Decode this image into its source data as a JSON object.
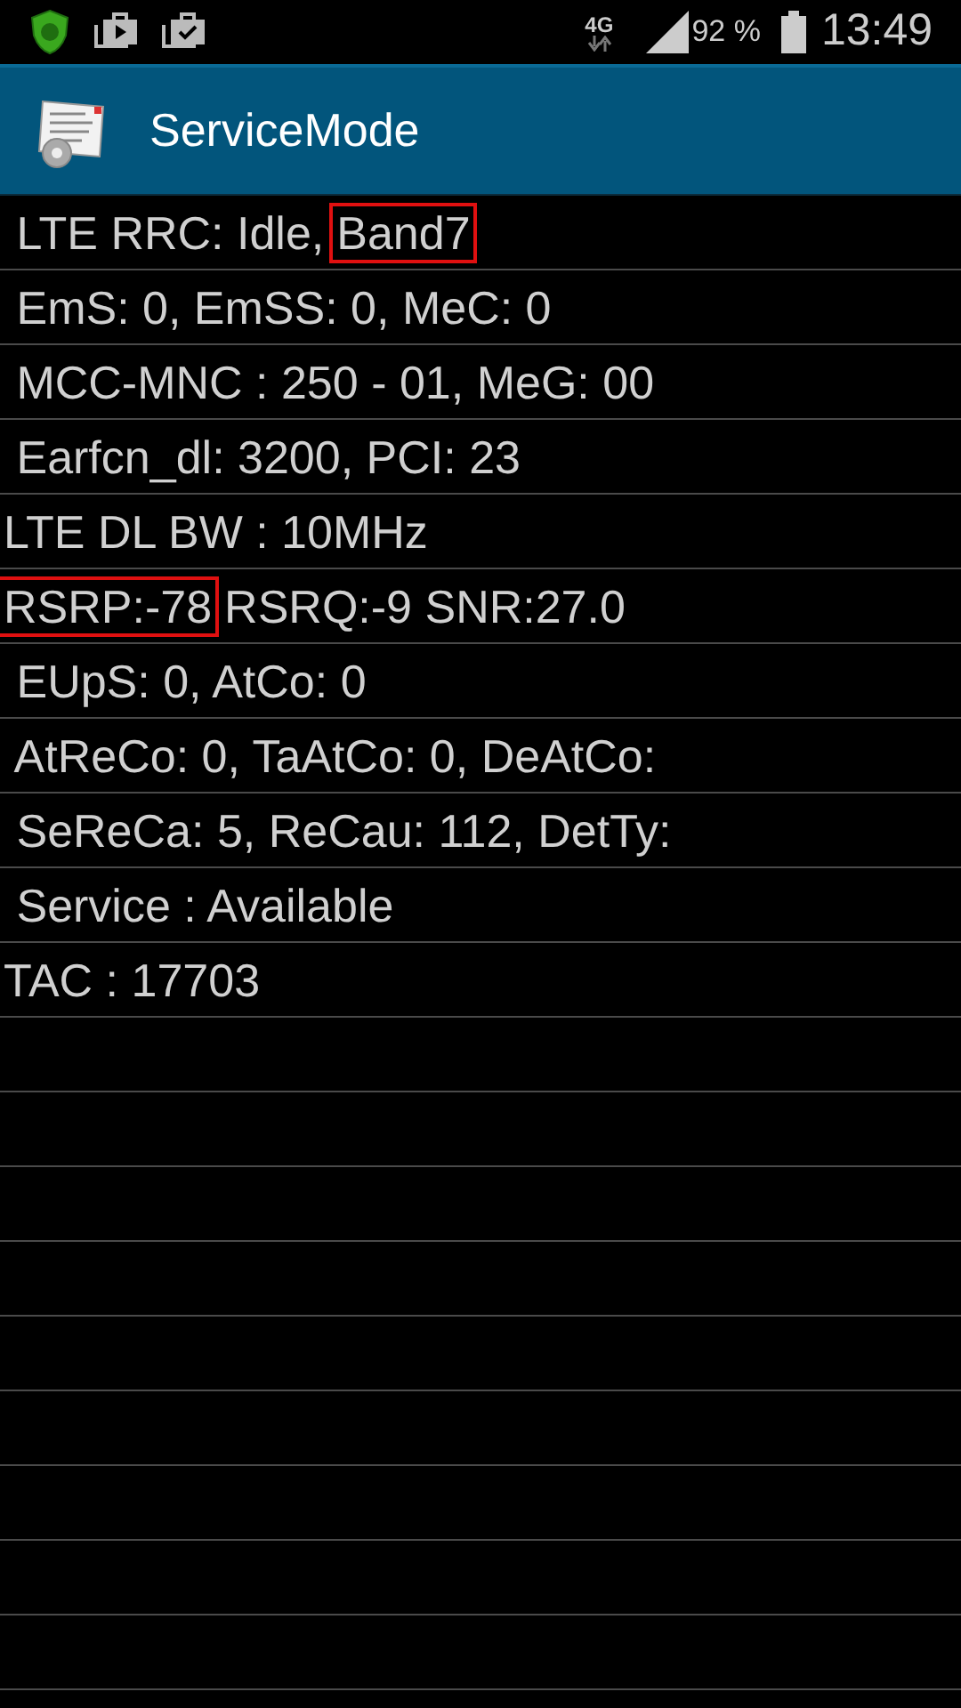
{
  "status_bar": {
    "network": "4G",
    "battery": "92 %",
    "time": "13:49"
  },
  "app_bar": {
    "title": "ServiceMode"
  },
  "rows": [
    {
      "segments": [
        {
          "text": " LTE RRC: Idle,",
          "highlighted": false
        },
        {
          "text": "Band7",
          "highlighted": true
        }
      ]
    },
    {
      "segments": [
        {
          "text": " EmS: 0, EmSS: 0, MeC: 0",
          "highlighted": false
        }
      ]
    },
    {
      "segments": [
        {
          "text": " MCC-MNC : 250 - 01, MeG: 00",
          "highlighted": false
        }
      ]
    },
    {
      "segments": [
        {
          "text": " Earfcn_dl: 3200, PCI: 23",
          "highlighted": false
        }
      ]
    },
    {
      "segments": [
        {
          "text": "LTE DL BW : 10MHz",
          "highlighted": false
        }
      ]
    },
    {
      "segments": [
        {
          "text": "RSRP:-78",
          "highlighted": true
        },
        {
          "text": "RSRQ:-9 SNR:27.0",
          "highlighted": false
        }
      ]
    },
    {
      "segments": [
        {
          "text": " EUpS: 0, AtCo: 0",
          "highlighted": false
        }
      ]
    },
    {
      "segments": [
        {
          "text": " AtReCo: 0, TaAtCo: 0, DeAtCo:",
          "highlighted": false
        }
      ]
    },
    {
      "segments": [
        {
          "text": " SeReCa: 5, ReCau: 112, DetTy:",
          "highlighted": false
        }
      ]
    },
    {
      "segments": [
        {
          "text": " Service : Available",
          "highlighted": false
        }
      ]
    },
    {
      "segments": [
        {
          "text": "TAC : 17703",
          "highlighted": false
        }
      ]
    }
  ]
}
